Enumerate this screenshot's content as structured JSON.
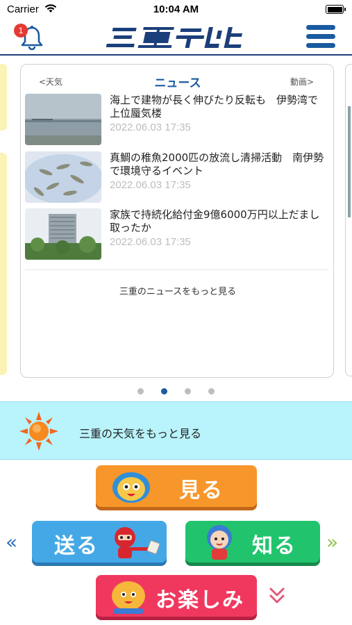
{
  "status_bar": {
    "carrier": "Carrier",
    "time": "10:04 AM"
  },
  "header": {
    "notification_count": "1",
    "logo_text": "三重テレビ"
  },
  "news_card": {
    "prev_label": "<天気",
    "title": "ニュース",
    "next_label": "動画>",
    "items": [
      {
        "headline": "海上で建物が長く伸びたり反転も　伊勢湾で上位蜃気楼",
        "date": "2022.06.03 17:35"
      },
      {
        "headline": "真鯛の稚魚2000匹の放流し清掃活動　南伊勢で環境守るイベント",
        "date": "2022.06.03 17:35"
      },
      {
        "headline": "家族で持続化給付金9億6000万円以上だまし取ったか",
        "date": "2022.06.03 17:35"
      }
    ],
    "more_label": "三重のニュースをもっと見る"
  },
  "pager": {
    "total": 4,
    "active_index": 1
  },
  "weather_banner": {
    "text": "三重の天気をもっと見る"
  },
  "menu_buttons": {
    "miru": "見る",
    "okuru": "送る",
    "shiru": "知る",
    "otanoshimi": "お楽しみ"
  },
  "colors": {
    "brand_blue": "#1a5aa0",
    "miru": "#f7962a",
    "okuru": "#45a8e6",
    "shiru": "#21c46d",
    "otanoshimi": "#f0385e",
    "weather_bg": "#b9f3fb"
  }
}
